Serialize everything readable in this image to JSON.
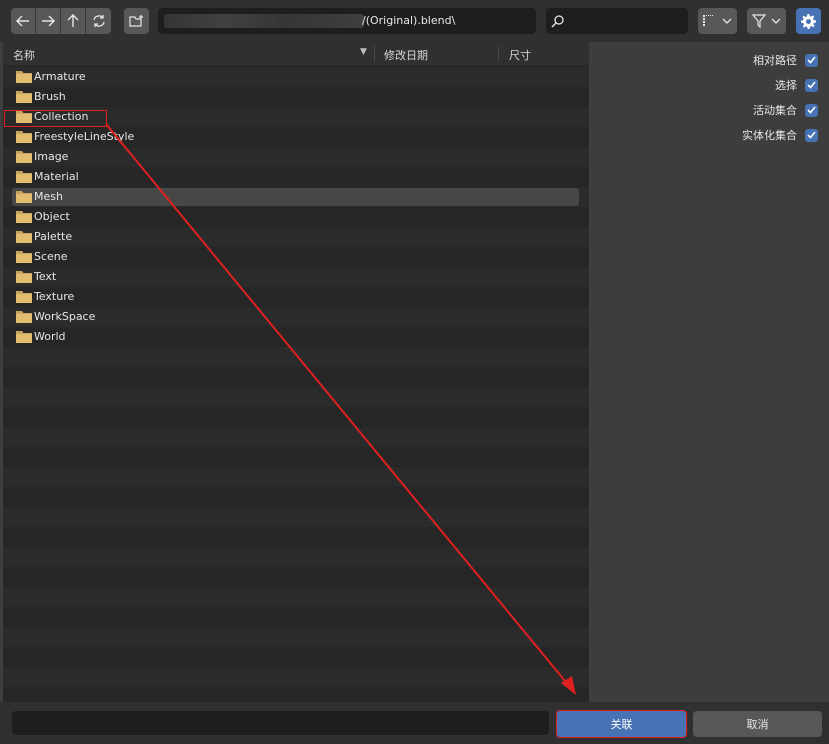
{
  "toolbar": {
    "nav_icons": [
      "arrow-left-icon",
      "arrow-right-icon",
      "parent-dir-icon",
      "refresh-icon"
    ],
    "new_folder_icon": "new-folder-icon",
    "path_value": "/(Original).blend\\",
    "search_value": "",
    "display_mode_icon": "list-display-icon",
    "filter_icon": "filter-icon",
    "settings_icon": "gear-icon"
  },
  "list": {
    "columns": {
      "name": "名称",
      "modified": "修改日期",
      "size": "尺寸"
    },
    "items": [
      {
        "name": "Armature"
      },
      {
        "name": "Brush"
      },
      {
        "name": "Collection"
      },
      {
        "name": "FreestyleLineStyle"
      },
      {
        "name": "Image"
      },
      {
        "name": "Material"
      },
      {
        "name": "Mesh"
      },
      {
        "name": "Object"
      },
      {
        "name": "Palette"
      },
      {
        "name": "Scene"
      },
      {
        "name": "Text"
      },
      {
        "name": "Texture"
      },
      {
        "name": "WorkSpace"
      },
      {
        "name": "World"
      }
    ],
    "selected_index": 6
  },
  "options": [
    {
      "label": "相对路径",
      "checked": true
    },
    {
      "label": "选择",
      "checked": true
    },
    {
      "label": "活动集合",
      "checked": true
    },
    {
      "label": "实体化集合",
      "checked": true
    }
  ],
  "bottom": {
    "filename_value": "",
    "link_label": "关联",
    "cancel_label": "取消"
  },
  "colors": {
    "accent": "#4772b3",
    "annotation": "#e02020"
  }
}
